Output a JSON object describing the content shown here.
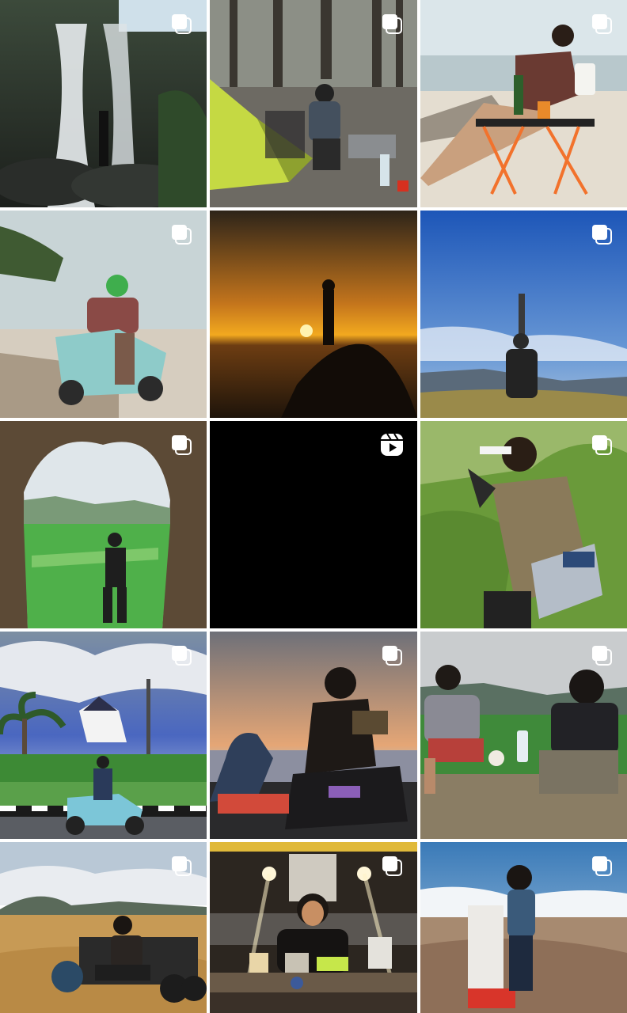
{
  "grid": {
    "columns": 3,
    "background": "#ffffff",
    "posts": [
      {
        "subject": "waterfall",
        "badge": "carousel-icon"
      },
      {
        "subject": "forest-camping",
        "badge": "carousel-icon"
      },
      {
        "subject": "beach-chair-drink",
        "badge": "carousel-icon"
      },
      {
        "subject": "scooter-beach",
        "badge": "carousel-icon"
      },
      {
        "subject": "sunset-silhouette",
        "badge": "none"
      },
      {
        "subject": "hilltop-blue-sky",
        "badge": "carousel-icon"
      },
      {
        "subject": "cave-view-rice-field",
        "badge": "carousel-icon"
      },
      {
        "subject": "black-reel",
        "badge": "reels-icon"
      },
      {
        "subject": "sunglasses-green-hills",
        "badge": "carousel-icon"
      },
      {
        "subject": "scooter-palm-house",
        "badge": "carousel-icon"
      },
      {
        "subject": "reading-on-scooter-sunset",
        "badge": "carousel-icon"
      },
      {
        "subject": "two-friends-field",
        "badge": "carousel-icon"
      },
      {
        "subject": "grassland-vehicle",
        "badge": "carousel-icon"
      },
      {
        "subject": "night-food-stall",
        "badge": "carousel-icon"
      },
      {
        "subject": "summit-marker",
        "badge": "carousel-icon"
      }
    ]
  }
}
